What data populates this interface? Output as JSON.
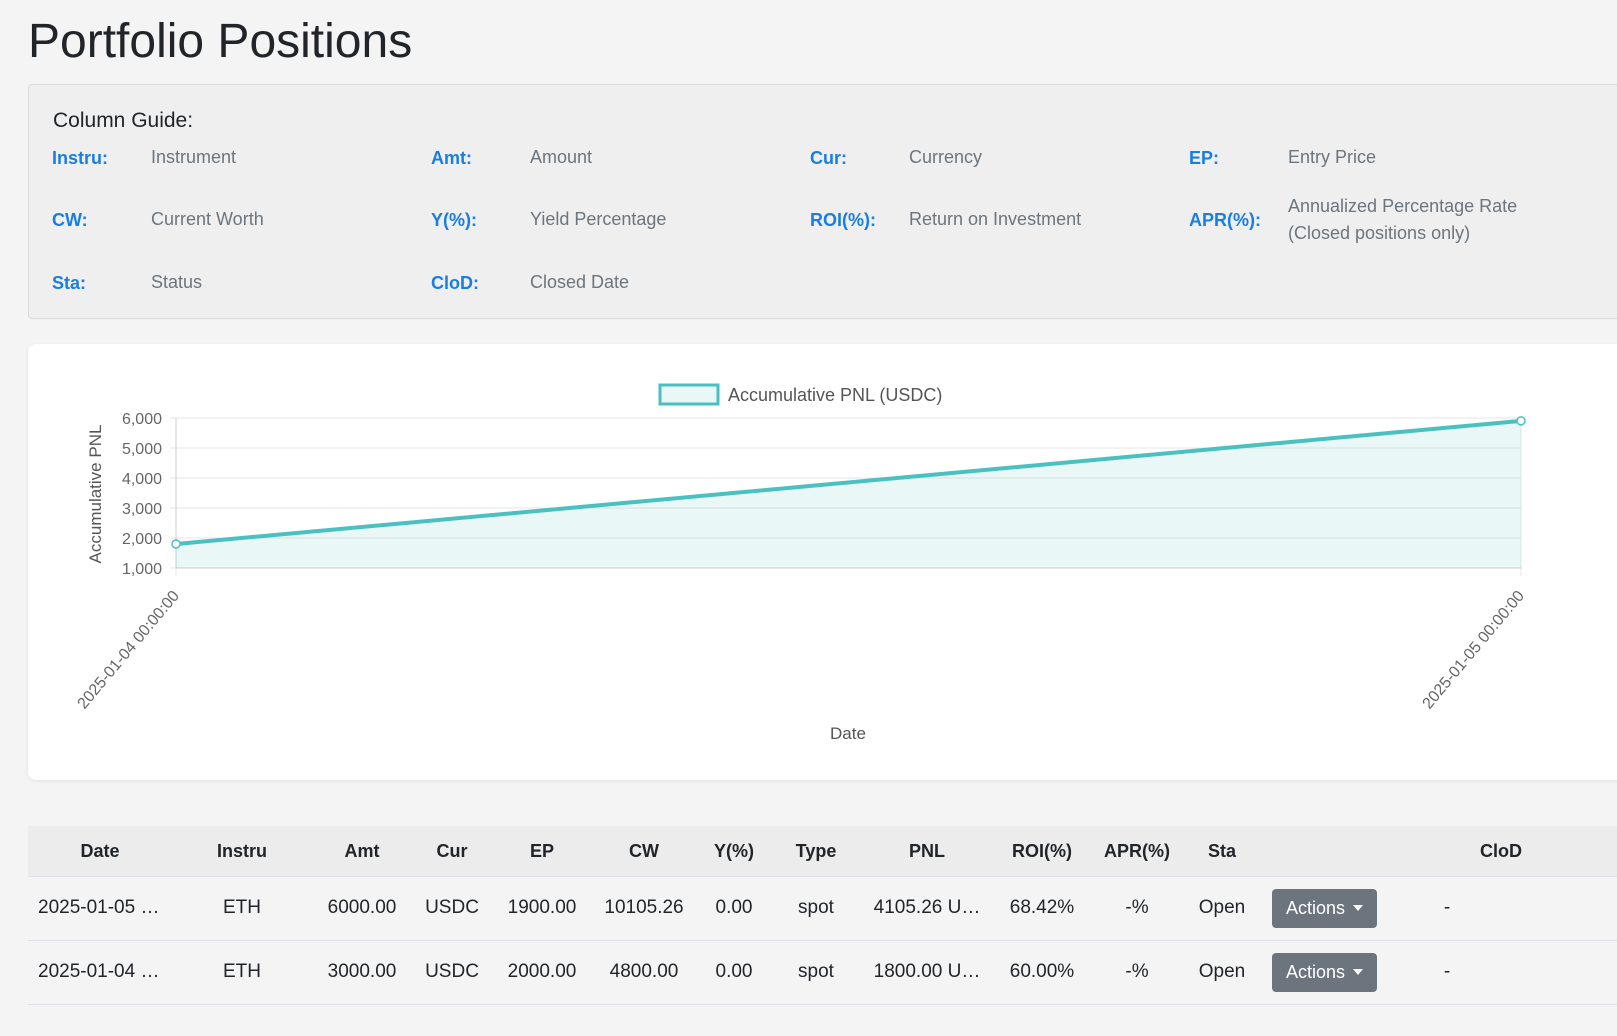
{
  "page": {
    "title": "Portfolio Positions"
  },
  "guide": {
    "title": "Column Guide:",
    "items": [
      {
        "key": "Instru:",
        "value": "Instrument"
      },
      {
        "key": "Amt:",
        "value": "Amount"
      },
      {
        "key": "Cur:",
        "value": "Currency"
      },
      {
        "key": "EP:",
        "value": "Entry Price"
      },
      {
        "key": "CW:",
        "value": "Current Worth"
      },
      {
        "key": "Y(%):",
        "value": "Yield Percentage"
      },
      {
        "key": "ROI(%):",
        "value": "Return on Investment"
      },
      {
        "key": "APR(%):",
        "value": "Annualized Percentage Rate",
        "value2": "(Closed positions only)"
      },
      {
        "key": "Sta:",
        "value": "Status"
      },
      {
        "key": "ClοD:",
        "value": "Closed Date"
      }
    ]
  },
  "chart_data": {
    "type": "line",
    "title": "",
    "legend": "Accumulative PNL (USDC)",
    "legend_position": "top",
    "xlabel": "Date",
    "ylabel": "Accumulative PNL",
    "x": [
      "2025-01-04 00:00:00",
      "2025-01-05 00:00:00"
    ],
    "series": [
      {
        "name": "Accumulative PNL (USDC)",
        "values": [
          1800,
          5905.26
        ]
      }
    ],
    "ylim": [
      1000,
      6000
    ],
    "yticks": [
      "1,000",
      "2,000",
      "3,000",
      "4,000",
      "5,000",
      "6,000"
    ],
    "grid": true,
    "fill": true,
    "color": "#4bc0c0"
  },
  "table": {
    "headers": [
      "Date",
      "Instru",
      "Amt",
      "Cur",
      "EP",
      "CW",
      "Y(%)",
      "Type",
      "PNL",
      "ROI(%)",
      "APR(%)",
      "Sta",
      "",
      "ClοD"
    ],
    "action_label": "Actions",
    "rows": [
      {
        "date": "2025-01-05 …",
        "instru": "ETH",
        "amt": "6000.00",
        "cur": "USDC",
        "ep": "1900.00",
        "cw": "10105.26",
        "y": "0.00",
        "type": "spot",
        "pnl": "4105.26 U…",
        "roi": "68.42%",
        "apr": "-%",
        "sta": "Open",
        "clod": "-"
      },
      {
        "date": "2025-01-04 …",
        "instru": "ETH",
        "amt": "3000.00",
        "cur": "USDC",
        "ep": "2000.00",
        "cw": "4800.00",
        "y": "0.00",
        "type": "spot",
        "pnl": "1800.00 U…",
        "roi": "60.00%",
        "apr": "-%",
        "sta": "Open",
        "clod": "-"
      }
    ]
  },
  "colors": {
    "accent": "#1a7ee0",
    "line": "#4bc0c0",
    "button": "#6c757d"
  }
}
